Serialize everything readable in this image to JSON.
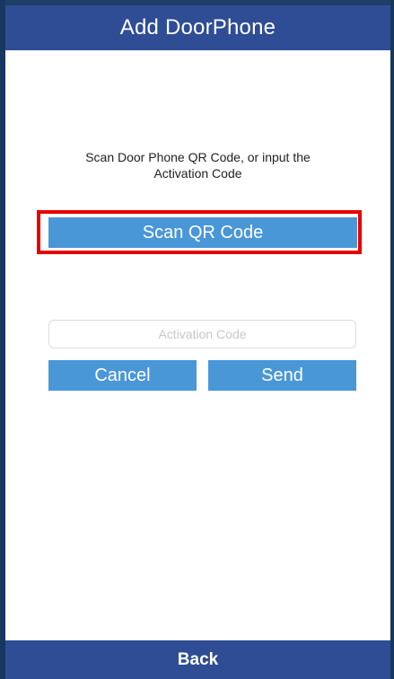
{
  "header": {
    "title": "Add DoorPhone"
  },
  "main": {
    "instruction_line1": "Scan Door Phone QR Code, or input the",
    "instruction_line2": "Activation Code",
    "scan_button_label": "Scan QR Code",
    "activation_code": {
      "value": "",
      "placeholder": "Activation Code"
    },
    "cancel_button_label": "Cancel",
    "send_button_label": "Send"
  },
  "footer": {
    "back_label": "Back"
  },
  "colors": {
    "bar_background": "#2f4d95",
    "button_background": "#4a97d8",
    "highlight_border": "#e60000",
    "content_background": "#ffffff"
  }
}
